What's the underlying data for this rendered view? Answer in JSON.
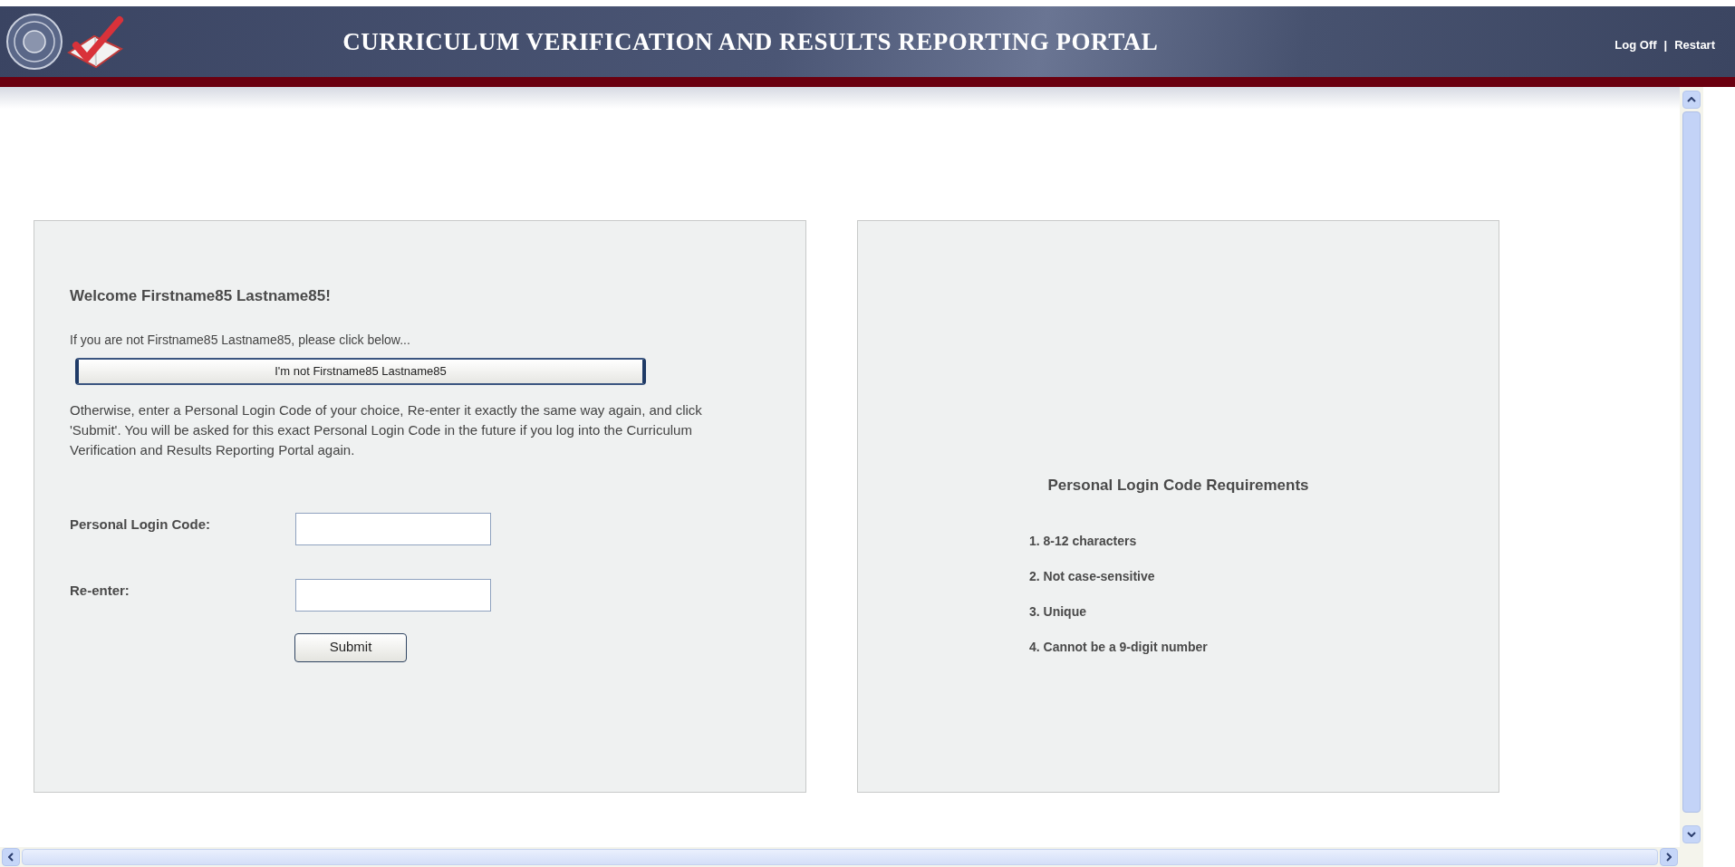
{
  "header": {
    "title": "CURRICULUM VERIFICATION AND RESULTS REPORTING PORTAL",
    "links": [
      "Log Off",
      "Restart"
    ],
    "separator": "|"
  },
  "welcome_panel": {
    "heading": "Welcome Firstname85 Lastname85!",
    "prompt": "If you are not Firstname85 Lastname85, please click below...",
    "not_me_button": "I'm not Firstname85 Lastname85",
    "instructions": "Otherwise, enter a Personal Login Code of your choice, Re-enter it exactly the same way again, and click 'Submit'. You will be asked for this exact Personal Login Code in the future if you log into the Curriculum Verification and Results Reporting Portal again.",
    "fields": [
      {
        "label": "Personal Login Code:"
      },
      {
        "label": "Re-enter:"
      }
    ],
    "submit_button": "Submit"
  },
  "requirements_panel": {
    "heading": "Personal Login Code Requirements",
    "items": [
      "1. 8-12 characters",
      "2. Not case-sensitive",
      "3. Unique",
      "4. Cannot be a 9-digit number"
    ]
  }
}
